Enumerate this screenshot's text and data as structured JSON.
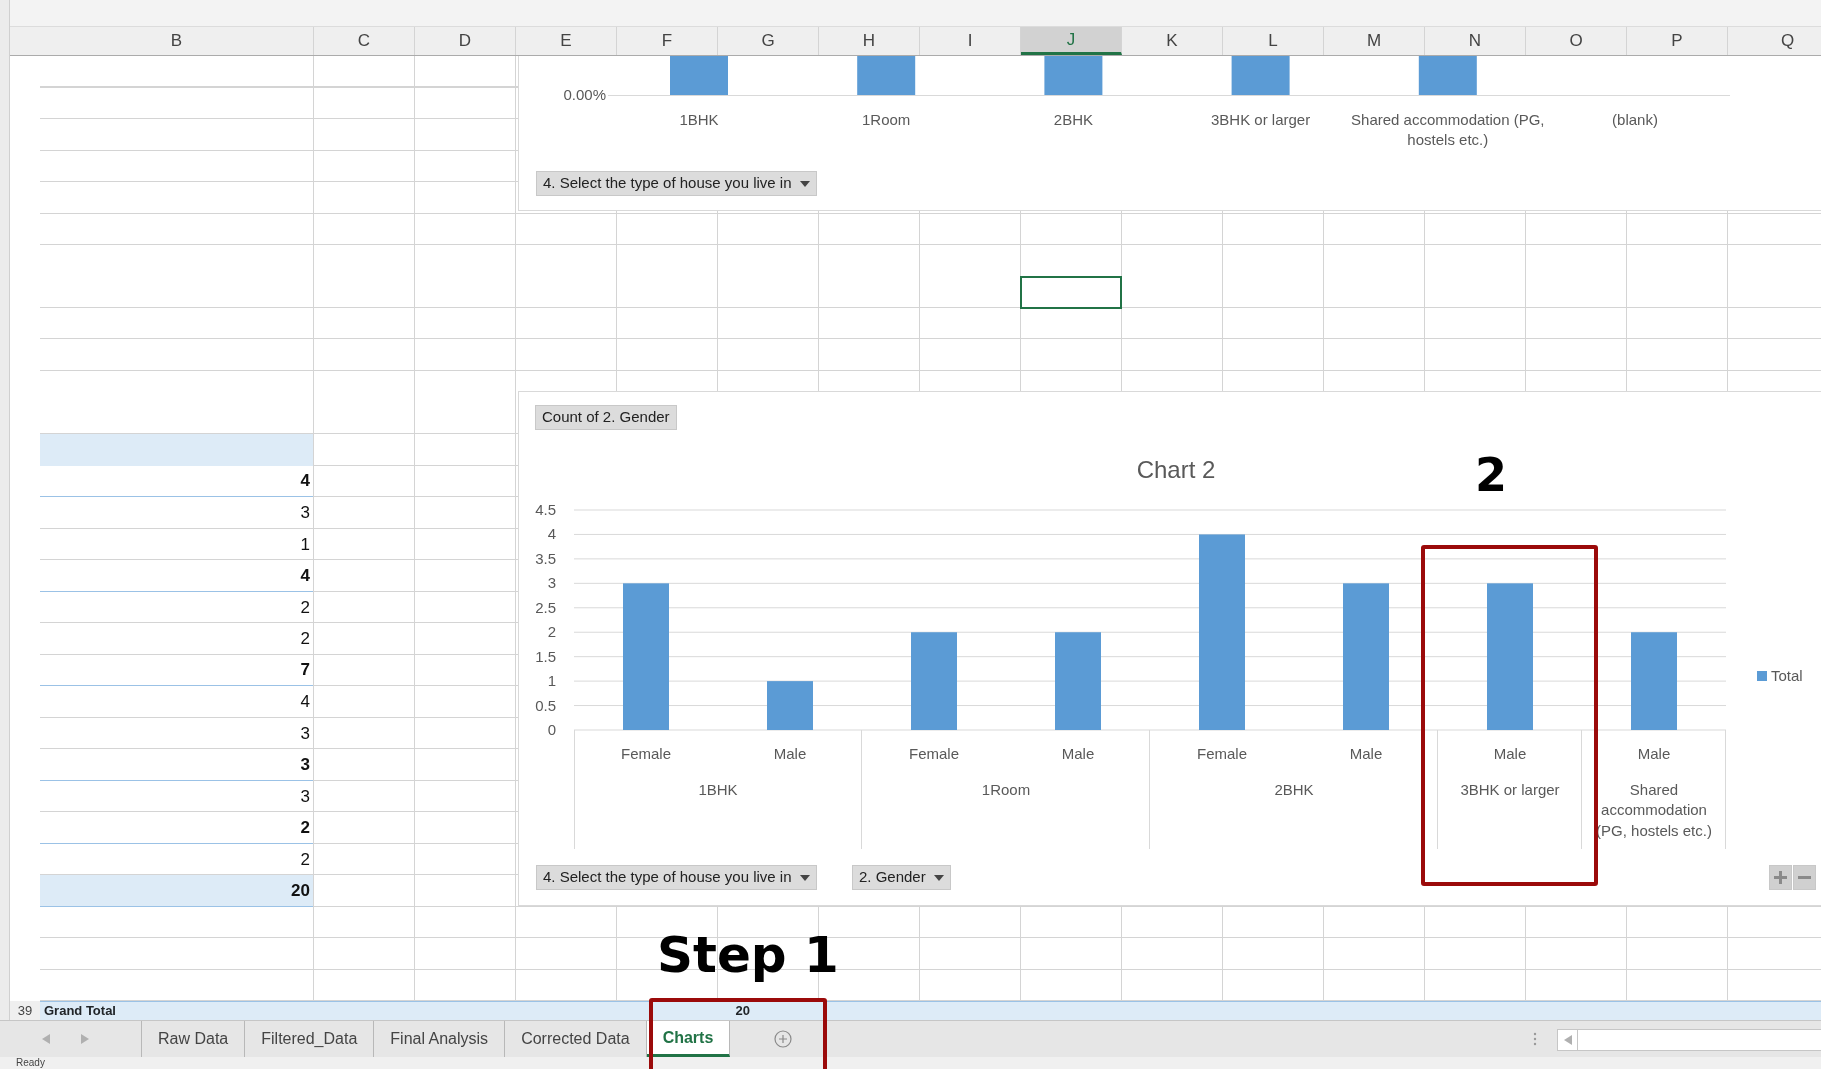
{
  "columns": [
    {
      "label": "B",
      "selected": false
    },
    {
      "label": "C",
      "selected": false
    },
    {
      "label": "D",
      "selected": false
    },
    {
      "label": "E",
      "selected": false
    },
    {
      "label": "F",
      "selected": false
    },
    {
      "label": "G",
      "selected": false
    },
    {
      "label": "H",
      "selected": false
    },
    {
      "label": "I",
      "selected": false
    },
    {
      "label": "J",
      "selected": true
    },
    {
      "label": "K",
      "selected": false
    },
    {
      "label": "L",
      "selected": false
    },
    {
      "label": "M",
      "selected": false
    },
    {
      "label": "N",
      "selected": false
    },
    {
      "label": "O",
      "selected": false
    },
    {
      "label": "P",
      "selected": false
    },
    {
      "label": "Q",
      "selected": false
    }
  ],
  "pivot": {
    "rows": [
      {
        "value": "4",
        "kind": "group"
      },
      {
        "value": "3",
        "kind": "item"
      },
      {
        "value": "1",
        "kind": "item"
      },
      {
        "value": "4",
        "kind": "group"
      },
      {
        "value": "2",
        "kind": "item"
      },
      {
        "value": "2",
        "kind": "item"
      },
      {
        "value": "7",
        "kind": "group"
      },
      {
        "value": "4",
        "kind": "item"
      },
      {
        "value": "3",
        "kind": "item"
      },
      {
        "value": "3",
        "kind": "group"
      },
      {
        "value": "3",
        "kind": "item"
      },
      {
        "value": "2",
        "kind": "group"
      },
      {
        "value": "2",
        "kind": "item"
      }
    ],
    "total": "20"
  },
  "grand_total_row": {
    "row_number": "39",
    "label": "Grand Total",
    "value": "20"
  },
  "chart_1": {
    "axis_label": "0.00%",
    "categories": [
      {
        "label": "1BHK",
        "has_bar": true
      },
      {
        "label": "1Room",
        "has_bar": true
      },
      {
        "label": "2BHK",
        "has_bar": true
      },
      {
        "label": "3BHK or larger",
        "has_bar": true
      },
      {
        "label": "Shared accommodation (PG, hostels etc.)",
        "has_bar": true
      },
      {
        "label": "(blank)",
        "has_bar": false
      }
    ],
    "field_button": "4. Select the type of house you live in"
  },
  "chart_2": {
    "value_button": "Count of 2. Gender",
    "chart_data": {
      "type": "bar",
      "title": "Chart 2",
      "grid": true,
      "series": [
        {
          "name": "Total",
          "color": "#5b9bd5",
          "values": [
            3,
            1,
            2,
            2,
            4,
            3,
            3,
            2
          ]
        }
      ],
      "ylim": [
        0,
        4.5
      ],
      "yticks": [
        0,
        0.5,
        1,
        1.5,
        2,
        2.5,
        3,
        3.5,
        4,
        4.5
      ]
    },
    "category_groups": [
      {
        "label": "1BHK",
        "categories": [
          "Female",
          "Male"
        ]
      },
      {
        "label": "1Room",
        "categories": [
          "Female",
          "Male"
        ]
      },
      {
        "label": "2BHK",
        "categories": [
          "Female",
          "Male"
        ]
      },
      {
        "label": "3BHK or larger",
        "categories": [
          "Male"
        ]
      },
      {
        "label": "Shared accommodation (PG, hostels etc.)",
        "categories": [
          "Male"
        ]
      }
    ],
    "field_buttons": [
      "4. Select the type of house you live in",
      "2. Gender"
    ]
  },
  "sheet_tabs": [
    {
      "label": "Raw Data",
      "selected": false
    },
    {
      "label": "Filtered_Data",
      "selected": false
    },
    {
      "label": "Final Analysis",
      "selected": false
    },
    {
      "label": "Corrected Data",
      "selected": false
    },
    {
      "label": "Charts",
      "selected": true
    }
  ],
  "status_bar": "Ready",
  "annotations": [
    {
      "kind": "label",
      "text": "2"
    },
    {
      "kind": "box"
    },
    {
      "kind": "label",
      "text": "Step 1"
    },
    {
      "kind": "box"
    }
  ]
}
